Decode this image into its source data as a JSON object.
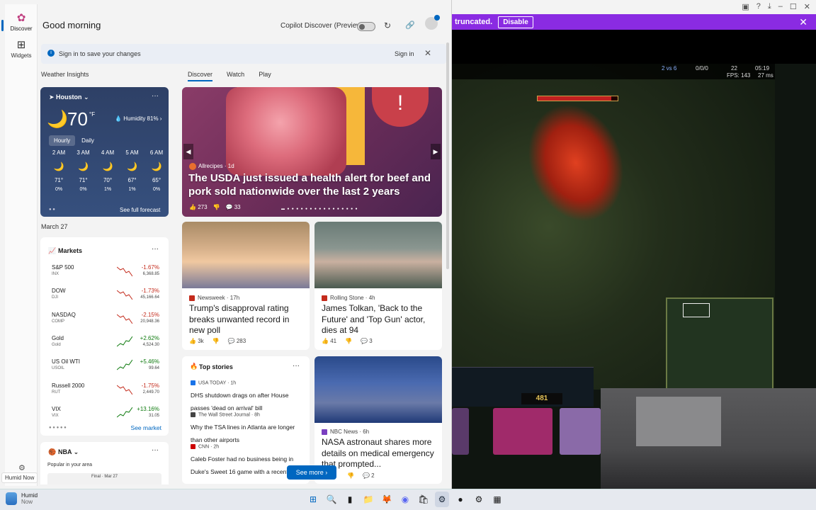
{
  "rail": {
    "discover": "Discover",
    "widgets": "Widgets",
    "tooltip": "Humid Now"
  },
  "header": {
    "greeting": "Good morning",
    "copilot_label": "Copilot Discover (Preview)"
  },
  "signin_bar": {
    "message": "Sign in to save your changes",
    "link": "Sign in"
  },
  "weather_insights": "Weather Insights",
  "feed_tabs": [
    "Discover",
    "Watch",
    "Play"
  ],
  "weather": {
    "location": "Houston",
    "temp": "70",
    "unit": "°F",
    "humidity": "Humidity 81%",
    "tabs": [
      "Hourly",
      "Daily"
    ],
    "forecast": [
      {
        "time": "2 AM",
        "temp": "71°",
        "precip": "0%"
      },
      {
        "time": "3 AM",
        "temp": "71°",
        "precip": "0%"
      },
      {
        "time": "4 AM",
        "temp": "70°",
        "precip": "1%"
      },
      {
        "time": "5 AM",
        "temp": "67°",
        "precip": "1%"
      },
      {
        "time": "6 AM",
        "temp": "65°",
        "precip": "0%"
      }
    ],
    "full_forecast": "See full forecast"
  },
  "date_label": "March 27",
  "hero": {
    "source": "Allrecipes · 1d",
    "headline": "The USDA just issued a health alert for beef and pork sold nationwide over the last 2 years",
    "likes": "273",
    "comments": "33"
  },
  "cards": {
    "trump": {
      "source": "Newsweek · 17h",
      "headline": "Trump's disapproval rating breaks unwanted record in new poll",
      "likes": "3k",
      "comments": "283"
    },
    "tolkan": {
      "source": "Rolling Stone · 4h",
      "headline": "James Tolkan, 'Back to the Future' and 'Top Gun' actor, dies at 94",
      "likes": "41",
      "comments": "3"
    },
    "nasa": {
      "source": "NBC News · 6h",
      "headline": "NASA astronaut shares more details on medical emergency that prompted...",
      "comments": "2"
    }
  },
  "markets": {
    "title": "Markets",
    "rows": [
      {
        "name": "S&P 500",
        "sub": "INX",
        "change": "-1.67%",
        "price": "6,368.85",
        "dir": "neg"
      },
      {
        "name": "DOW",
        "sub": "DJI",
        "change": "-1.73%",
        "price": "45,166.64",
        "dir": "neg"
      },
      {
        "name": "NASDAQ",
        "sub": "COMP",
        "change": "-2.15%",
        "price": "20,948.36",
        "dir": "neg"
      },
      {
        "name": "Gold",
        "sub": "Gold",
        "change": "+2.62%",
        "price": "4,524.30",
        "dir": "pos"
      },
      {
        "name": "US Oil WTI",
        "sub": "USOIL",
        "change": "+5.46%",
        "price": "99.64",
        "dir": "pos"
      },
      {
        "name": "Russell 2000",
        "sub": "RUT",
        "change": "-1.75%",
        "price": "2,449.70",
        "dir": "neg"
      },
      {
        "name": "VIX",
        "sub": "VIX",
        "change": "+13.16%",
        "price": "31.05",
        "dir": "pos"
      }
    ],
    "see_more": "See market"
  },
  "top_stories": {
    "title": "Top stories",
    "items": [
      {
        "source": "USA TODAY · 1h",
        "headline": "DHS shutdown drags on after House passes 'dead on arrival' bill"
      },
      {
        "source": "The Wall Street Journal · 8h",
        "headline": "Why the TSA lines in Atlanta are longer than other airports"
      },
      {
        "source": "CNN · 2h",
        "headline": "Caleb Foster had no business being in Duke's Sweet 16 game with a recently..."
      }
    ],
    "see_more": "See more"
  },
  "nba": {
    "title": "NBA",
    "sub": "Popular in your area",
    "final": "Final · Mar 27"
  },
  "game": {
    "banner_text": "truncated.",
    "banner_button": "Disable",
    "score": "2 vs 6",
    "kda": "0/0/0",
    "cs": "22",
    "time": "05:19",
    "fps": "FPS: 143",
    "ping": "27 ms",
    "gold": "481"
  },
  "taskbar": {
    "weather_title": "Humid",
    "weather_sub": "Now"
  }
}
